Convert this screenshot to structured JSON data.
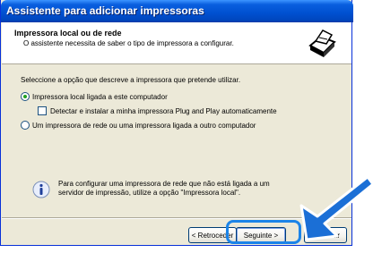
{
  "window": {
    "title": "Assistente para adicionar impressoras"
  },
  "header": {
    "title": "Impressora local ou de rede",
    "subtitle": "O assistente necessita de saber o tipo de impressora a configurar.",
    "icon": "printer-icon"
  },
  "content": {
    "prompt": "Seleccione a opção que descreve a impressora que pretende utilizar.",
    "options": [
      {
        "label": "Impressora local ligada a este computador",
        "selected": true
      },
      {
        "label": "Detectar e instalar a minha impressora Plug and Play automaticamente",
        "checked": false
      },
      {
        "label": "Um impressora de rede ou uma impressora ligada a outro computador",
        "selected": false
      }
    ],
    "info_icon": "info-icon",
    "info_lines": [
      "Para configurar uma impressora de rede que não está ligada a um",
      "servidor de impressão, utilize a opção \"Impressora local\"."
    ]
  },
  "buttons": {
    "back": "< Retroceder",
    "next": "Seguinte >",
    "cancel": "Cancelar"
  },
  "colors": {
    "titlebar": "#0050d0",
    "dialog_bg": "#ece9d8",
    "highlight": "#1c84e8",
    "arrow": "#1b6fd6"
  }
}
